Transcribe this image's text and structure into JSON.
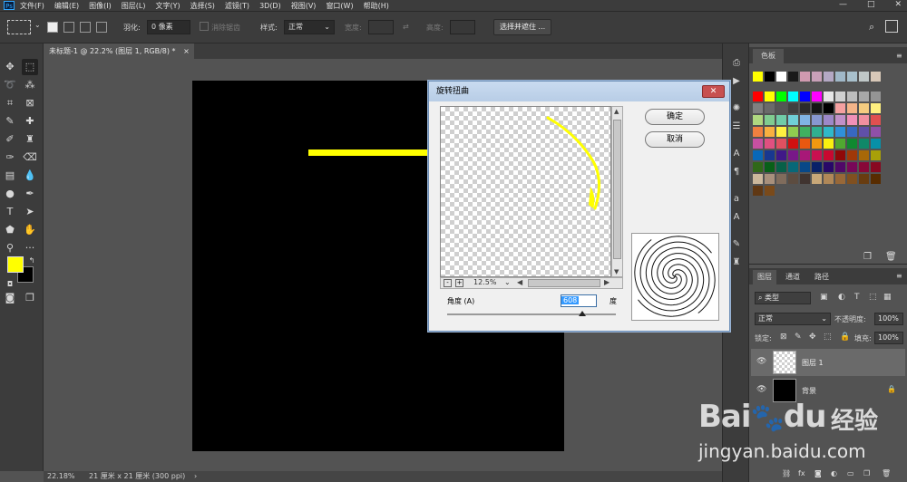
{
  "menubar": {
    "items": [
      "文件(F)",
      "编辑(E)",
      "图像(I)",
      "图层(L)",
      "文字(Y)",
      "选择(S)",
      "滤镜(T)",
      "3D(D)",
      "视图(V)",
      "窗口(W)",
      "帮助(H)"
    ],
    "logo": "Ps",
    "win_minimize": "—",
    "win_maximize": "□",
    "win_close": "✕"
  },
  "options": {
    "feather_label": "羽化:",
    "feather_value": "0 像素",
    "antialias_label": "消除锯齿",
    "style_label": "样式:",
    "style_value": "正常",
    "width_label": "宽度:",
    "height_label": "高度:",
    "select_mask_button": "选择并遮住 ..."
  },
  "document": {
    "tab_title": "未标题-1 @ 22.2% (图层 1, RGB/8) *",
    "tab_close": "×"
  },
  "status": {
    "zoom": "22.18%",
    "size": "21 厘米 x 21 厘米 (300 ppi)",
    "arrow": "›"
  },
  "swatches": {
    "tab_label": "色板",
    "rows": [
      [
        "#ffff00",
        "#000000",
        "#ffffff",
        "#1a1a1a",
        "#d09ab0",
        "#c8a0b8",
        "#b4a8c4",
        "#a0b8c8",
        "#a8c0cc",
        "#c0c8c8",
        "#d8c8b8"
      ],
      [
        "#ff0000",
        "#ffff00",
        "#00ff00",
        "#00ffff",
        "#0000ff",
        "#ff00ff",
        "#e6e6e6",
        "#d0d0d0",
        "#bdbdbd",
        "#a8a8a8",
        "#949494"
      ],
      [
        "#808080",
        "#6a6a6a",
        "#555555",
        "#404040",
        "#2b2b2b",
        "#151515",
        "#000000",
        "#f4a0a0",
        "#f4b488",
        "#f4cc80",
        "#fff080"
      ],
      [
        "#b0d880",
        "#80cc90",
        "#70cca8",
        "#70d0d8",
        "#80b4e4",
        "#8898d0",
        "#9c88c8",
        "#c090c8",
        "#f090b8",
        "#f090a0",
        "#e05050"
      ],
      [
        "#f08040",
        "#f8b040",
        "#fff040",
        "#90cc50",
        "#40b060",
        "#30b090",
        "#30b8c8",
        "#3090d8",
        "#3868c0",
        "#6050a8",
        "#9050a8"
      ],
      [
        "#c850a0",
        "#e05080",
        "#e05060",
        "#d01010",
        "#e85810",
        "#f09810",
        "#f8f010",
        "#50a830",
        "#108830",
        "#108868",
        "#0890a8"
      ],
      [
        "#0868b8",
        "#183890",
        "#401888",
        "#781888",
        "#a81878",
        "#c81050",
        "#c80830",
        "#900808",
        "#a03808",
        "#a86808",
        "#a8a008"
      ],
      [
        "#306818",
        "#086018",
        "#086048",
        "#086878",
        "#084888",
        "#082068",
        "#280868",
        "#500868",
        "#780858",
        "#880838",
        "#880820"
      ],
      [
        "#ccb89c",
        "#a8907c",
        "#806c5c",
        "#5c4c40",
        "#403430",
        "#c8a878",
        "#b08858",
        "#986838",
        "#805020",
        "#683c10",
        "#582c00"
      ],
      [
        "#603814",
        "#7a4a1a"
      ]
    ]
  },
  "layers": {
    "tabs": [
      "图层",
      "通道",
      "路径"
    ],
    "filter_label": "类型",
    "blend_mode": "正常",
    "opacity_label": "不透明度:",
    "opacity_value": "100%",
    "lock_label": "锁定:",
    "fill_label": "填充:",
    "fill_value": "100%",
    "items": [
      {
        "name": "图层 1"
      },
      {
        "name": "背景"
      }
    ]
  },
  "dialog": {
    "title": "旋转扭曲",
    "ok_button": "确定",
    "cancel_button": "取消",
    "zoom_level": "12.5%",
    "zoom_out": "-",
    "zoom_in": "+",
    "angle_label": "角度 (A)",
    "angle_value": "608",
    "angle_unit": "度",
    "angle_slider": 0.8,
    "close": "✕"
  },
  "watermark": {
    "brand": "Bai",
    "brand2": "du",
    "brand_cn": "经验",
    "url": "jingyan.baidu.com"
  },
  "colors": {
    "foreground": "#ffff00",
    "background": "#000000",
    "accent": "#31a8ff"
  }
}
